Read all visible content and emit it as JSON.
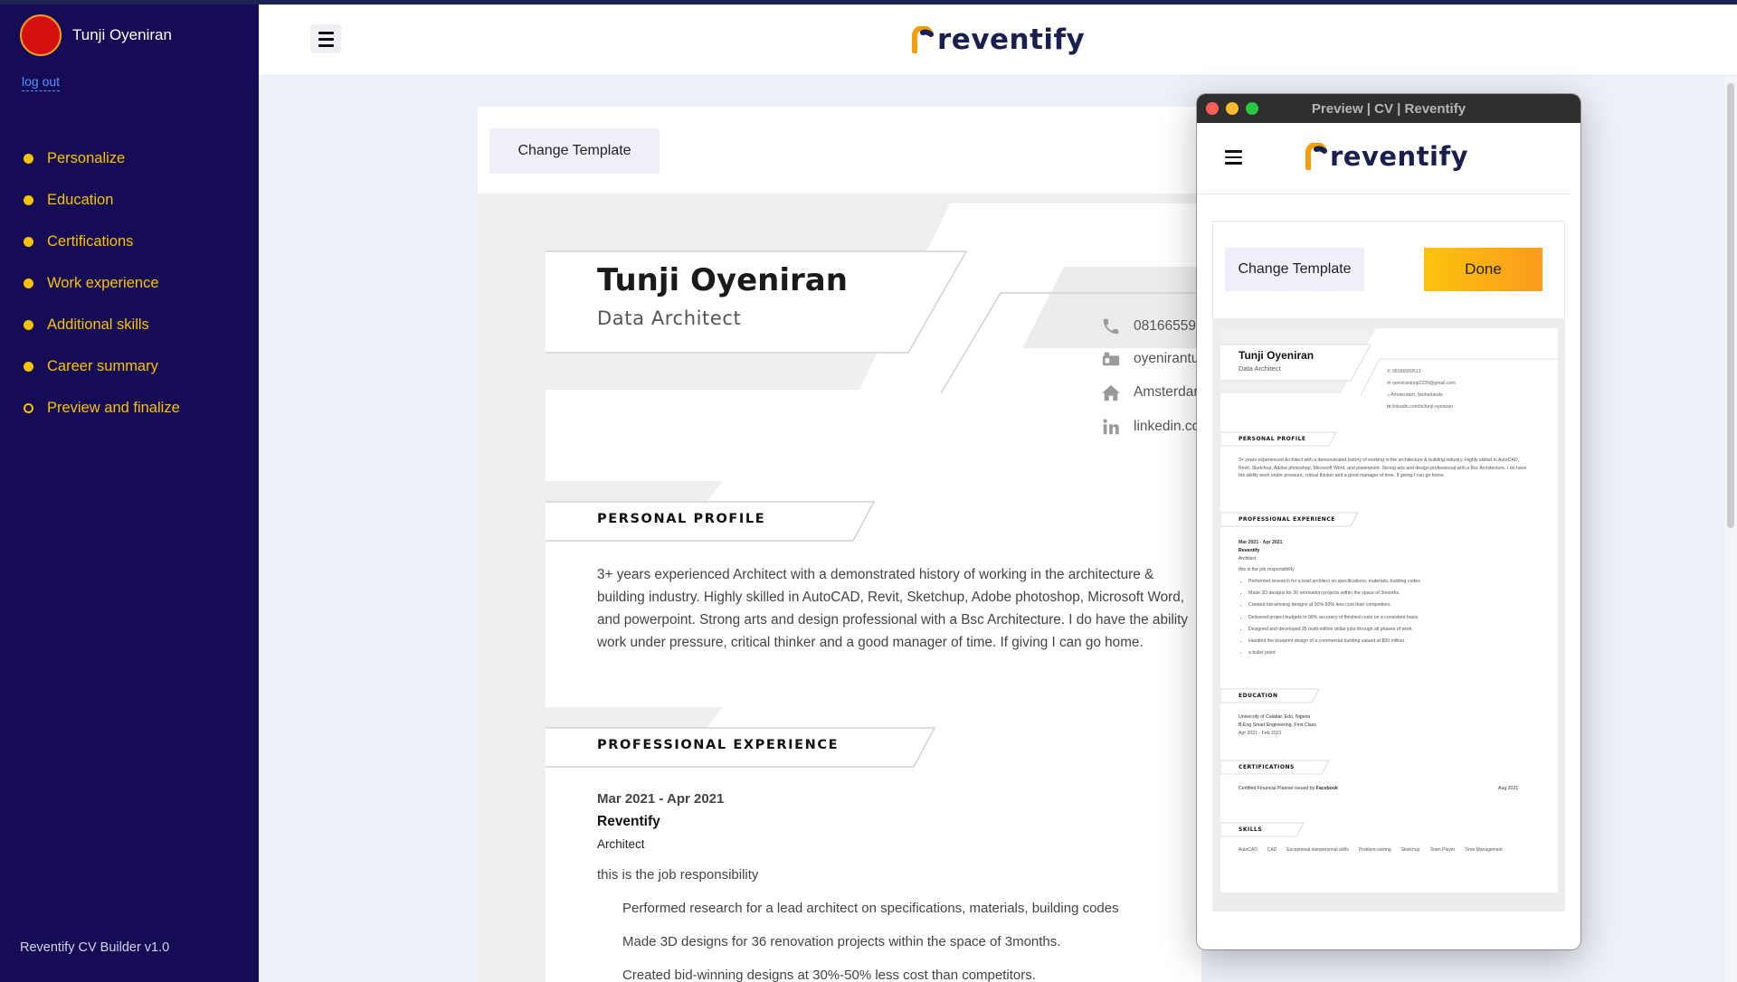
{
  "sidebar": {
    "user_name": "Tunji Oyeniran",
    "logout_label": "log out",
    "nav": [
      {
        "label": "Personalize",
        "state": "done"
      },
      {
        "label": "Education",
        "state": "done"
      },
      {
        "label": "Certifications",
        "state": "done"
      },
      {
        "label": "Work experience",
        "state": "done"
      },
      {
        "label": "Additional skills",
        "state": "done"
      },
      {
        "label": "Career summary",
        "state": "done"
      },
      {
        "label": "Preview and finalize",
        "state": "current"
      }
    ],
    "version": "Reventify CV Builder v1.0"
  },
  "header": {
    "brand": "reventify"
  },
  "editor": {
    "change_template_label": "Change Template"
  },
  "cv": {
    "name": "Tunji Oyeniran",
    "role": "Data Architect",
    "contacts": {
      "phone": "08166559513",
      "email": "oyenirantunji2339@gmail.com",
      "address": "Amsterdam, Netherlands",
      "linkedin": "linkedin.com/in/tunji-oyeniran"
    },
    "profile_title": "PERSONAL PROFILE",
    "profile_text": "3+ years experienced Architect with a demonstrated history of working in the architecture & building industry. Highly skilled in AutoCAD, Revit, Sketchup, Adobe photoshop, Microsoft Word, and powerpoint. Strong arts and design professional with a Bsc  Architecture. I do have the ability work under pressure, critical thinker and a good manager of time. If giving I can go home.",
    "experience_title": "PROFESSIONAL EXPERIENCE",
    "experience": {
      "dates": "Mar 2021 - Apr 2021",
      "company": "Reventify",
      "title": "Architect",
      "summary": "this is the job responsibility",
      "bullets": [
        "Performed research for a lead architect on specifications, materials, building codes",
        "Made 3D designs for 36 renovation projects within the space of 3months.",
        "Created bid-winning designs at 30%-50% less cost than competitors.",
        "Delivered project budgets to 98% accuracy of finished costs on a consistent basis.",
        "Designed and developed 35 multi-million dollar jobs through all phases of work.",
        "Handled the blueprint design of a commercial building valued at $50 million.",
        "a bullet point"
      ]
    },
    "education_title": "EDUCATION",
    "education": {
      "school": "University of Calabar, Edo, Nigeria",
      "degree": "B.Eng Smart Engineering, First Class",
      "dates": "Apr 2021 - Feb 2021"
    },
    "certifications_title": "CERTIFICATIONS",
    "certification": {
      "name": "Certified Financial Planner",
      "issued_by_prefix": "issued by",
      "issuer": "Facebook",
      "date": "Aug 2021"
    },
    "skills_title": "SKILLS",
    "skills": [
      "AutoCAD",
      "CAD",
      "Exceptional interpersonal skills",
      "Problem-solving",
      "Sketchup",
      "Team Player",
      "Time Management"
    ]
  },
  "preview": {
    "window_title": "Preview | CV | Reventify",
    "brand": "reventify",
    "change_template_label": "Change Template",
    "done_label": "Done"
  },
  "colors": {
    "sidebar_bg": "#160b55",
    "accent_yellow": "#f7c200",
    "done_gradient_start": "#fdc30e",
    "done_gradient_end": "#fb9b1c",
    "logout_link": "#4d9bff",
    "logo_orange": "#f59e0b",
    "logo_navy": "#191f4e"
  }
}
